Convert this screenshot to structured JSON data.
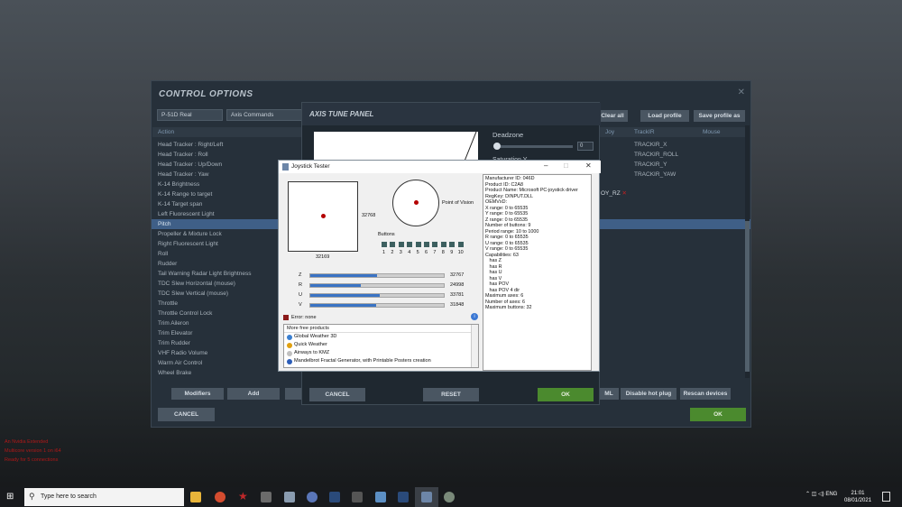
{
  "control_options": {
    "title": "CONTROL OPTIONS",
    "aircraft": "P-51D Real",
    "category": "Axis Commands",
    "buttons": {
      "clear_all": "Clear all",
      "load_profile": "Load profile",
      "save_profile": "Save profile as"
    },
    "columns": {
      "action": "Action",
      "joy": "Joy",
      "trackir": "TrackIR",
      "mouse": "Mouse"
    },
    "actions": [
      "Head Tracker : Right/Left",
      "Head Tracker : Roll",
      "Head Tracker : Up/Down",
      "Head Tracker : Yaw",
      "K-14 Brightness",
      "K-14 Range to target",
      "K-14 Target span",
      "Left Fluorescent Light",
      "Pitch",
      "Propeller & Mixture Lock",
      "Right Fluorescent Light",
      "Roll",
      "Rudder",
      "Tail Warning Radar Light Brightness",
      "TDC Slew Horizontal (mouse)",
      "TDC Slew Vertical (mouse)",
      "Throttle",
      "Throttle Control Lock",
      "Trim Aileron",
      "Trim Elevator",
      "Trim Rudder",
      "VHF Radio Volume",
      "Warm Air Control",
      "Wheel Brake"
    ],
    "trackir": [
      "TRACKIR_X",
      "TRACKIR_ROLL",
      "TRACKIR_Y",
      "TRACKIR_YAW"
    ],
    "joy_partial": "OY_RZ",
    "bottom": {
      "modifiers": "Modifiers",
      "add": "Add",
      "ml": "ML",
      "disable_hot_plug": "Disable hot plug",
      "rescan": "Rescan devices",
      "cancel": "CANCEL",
      "ok": "OK"
    }
  },
  "axis_tune": {
    "title": "AXIS TUNE PANEL",
    "deadzone_label": "Deadzone",
    "deadzone_value": "0",
    "saturation_label": "Saturation Y",
    "cancel": "CANCEL",
    "reset": "RESET",
    "ok": "OK"
  },
  "joystick_tester": {
    "title": "Joystick Tester",
    "xy_x_value": "32169",
    "xy_y_value": "32768",
    "pov_label": "Point of Vision",
    "buttons_label": "Buttons",
    "button_numbers": [
      "1",
      "2",
      "3",
      "4",
      "5",
      "6",
      "7",
      "8",
      "9",
      "10"
    ],
    "axes": [
      {
        "name": "Z",
        "value": "32767",
        "fraction": 0.5
      },
      {
        "name": "R",
        "value": "24998",
        "fraction": 0.38
      },
      {
        "name": "U",
        "value": "33781",
        "fraction": 0.52
      },
      {
        "name": "V",
        "value": "31848",
        "fraction": 0.49
      }
    ],
    "error": "Error: none",
    "products": [
      "More free products",
      "Global Weather 3D",
      "Quick Weather",
      "Airways to KMZ",
      "Mandelbrot Fractal Generator, with Printable Posters creation"
    ],
    "info": [
      "Manufacturer ID: 046D",
      "Product ID: C2A8",
      "Product Name: Microsoft PC-joystick driver",
      "RegKey: DINPUT.DLL",
      "OEMVxD:",
      "X range: 0 to 65535",
      "Y range: 0 to 65535",
      "Z range: 0 to 65535",
      "Number of buttons: 9",
      "Period range: 10 to 1000",
      "R range: 0 to 65535",
      "U range: 0 to 65535",
      "V range: 0 to 65535",
      "Capabilities: 63",
      "   has Z",
      "   has R",
      "   has U",
      "   has V",
      "   has POV",
      "   has POV 4 dir",
      "Maximum axes: 6",
      "Number of axes: 6",
      "Maximum buttons: 32"
    ]
  },
  "overlay_red": [
    "An Nvidia Extended",
    "Multicore version 1 on i64",
    "Ready for 5 connections"
  ],
  "taskbar": {
    "search_placeholder": "Type here to search",
    "lang": "ENG",
    "time": "21:01",
    "date": "08/01/2021"
  }
}
